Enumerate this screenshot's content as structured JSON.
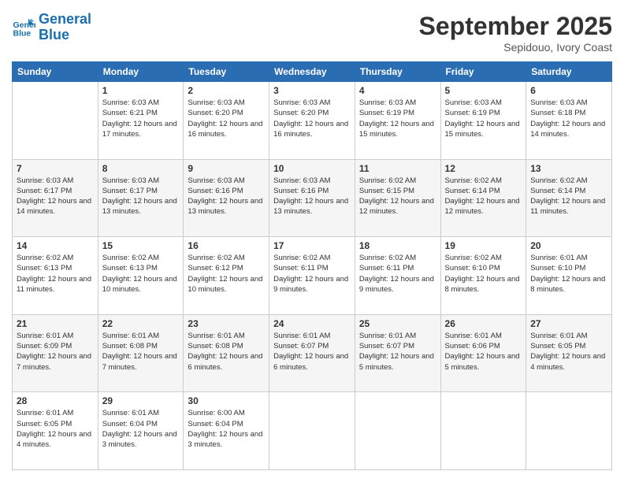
{
  "logo": {
    "line1": "General",
    "line2": "Blue"
  },
  "header": {
    "month": "September 2025",
    "location": "Sepidouo, Ivory Coast"
  },
  "weekdays": [
    "Sunday",
    "Monday",
    "Tuesday",
    "Wednesday",
    "Thursday",
    "Friday",
    "Saturday"
  ],
  "weeks": [
    [
      {
        "day": "",
        "info": ""
      },
      {
        "day": "1",
        "info": "Sunrise: 6:03 AM\nSunset: 6:21 PM\nDaylight: 12 hours\nand 17 minutes."
      },
      {
        "day": "2",
        "info": "Sunrise: 6:03 AM\nSunset: 6:20 PM\nDaylight: 12 hours\nand 16 minutes."
      },
      {
        "day": "3",
        "info": "Sunrise: 6:03 AM\nSunset: 6:20 PM\nDaylight: 12 hours\nand 16 minutes."
      },
      {
        "day": "4",
        "info": "Sunrise: 6:03 AM\nSunset: 6:19 PM\nDaylight: 12 hours\nand 15 minutes."
      },
      {
        "day": "5",
        "info": "Sunrise: 6:03 AM\nSunset: 6:19 PM\nDaylight: 12 hours\nand 15 minutes."
      },
      {
        "day": "6",
        "info": "Sunrise: 6:03 AM\nSunset: 6:18 PM\nDaylight: 12 hours\nand 14 minutes."
      }
    ],
    [
      {
        "day": "7",
        "info": "Sunrise: 6:03 AM\nSunset: 6:17 PM\nDaylight: 12 hours\nand 14 minutes."
      },
      {
        "day": "8",
        "info": "Sunrise: 6:03 AM\nSunset: 6:17 PM\nDaylight: 12 hours\nand 13 minutes."
      },
      {
        "day": "9",
        "info": "Sunrise: 6:03 AM\nSunset: 6:16 PM\nDaylight: 12 hours\nand 13 minutes."
      },
      {
        "day": "10",
        "info": "Sunrise: 6:03 AM\nSunset: 6:16 PM\nDaylight: 12 hours\nand 13 minutes."
      },
      {
        "day": "11",
        "info": "Sunrise: 6:02 AM\nSunset: 6:15 PM\nDaylight: 12 hours\nand 12 minutes."
      },
      {
        "day": "12",
        "info": "Sunrise: 6:02 AM\nSunset: 6:14 PM\nDaylight: 12 hours\nand 12 minutes."
      },
      {
        "day": "13",
        "info": "Sunrise: 6:02 AM\nSunset: 6:14 PM\nDaylight: 12 hours\nand 11 minutes."
      }
    ],
    [
      {
        "day": "14",
        "info": "Sunrise: 6:02 AM\nSunset: 6:13 PM\nDaylight: 12 hours\nand 11 minutes."
      },
      {
        "day": "15",
        "info": "Sunrise: 6:02 AM\nSunset: 6:13 PM\nDaylight: 12 hours\nand 10 minutes."
      },
      {
        "day": "16",
        "info": "Sunrise: 6:02 AM\nSunset: 6:12 PM\nDaylight: 12 hours\nand 10 minutes."
      },
      {
        "day": "17",
        "info": "Sunrise: 6:02 AM\nSunset: 6:11 PM\nDaylight: 12 hours\nand 9 minutes."
      },
      {
        "day": "18",
        "info": "Sunrise: 6:02 AM\nSunset: 6:11 PM\nDaylight: 12 hours\nand 9 minutes."
      },
      {
        "day": "19",
        "info": "Sunrise: 6:02 AM\nSunset: 6:10 PM\nDaylight: 12 hours\nand 8 minutes."
      },
      {
        "day": "20",
        "info": "Sunrise: 6:01 AM\nSunset: 6:10 PM\nDaylight: 12 hours\nand 8 minutes."
      }
    ],
    [
      {
        "day": "21",
        "info": "Sunrise: 6:01 AM\nSunset: 6:09 PM\nDaylight: 12 hours\nand 7 minutes."
      },
      {
        "day": "22",
        "info": "Sunrise: 6:01 AM\nSunset: 6:08 PM\nDaylight: 12 hours\nand 7 minutes."
      },
      {
        "day": "23",
        "info": "Sunrise: 6:01 AM\nSunset: 6:08 PM\nDaylight: 12 hours\nand 6 minutes."
      },
      {
        "day": "24",
        "info": "Sunrise: 6:01 AM\nSunset: 6:07 PM\nDaylight: 12 hours\nand 6 minutes."
      },
      {
        "day": "25",
        "info": "Sunrise: 6:01 AM\nSunset: 6:07 PM\nDaylight: 12 hours\nand 5 minutes."
      },
      {
        "day": "26",
        "info": "Sunrise: 6:01 AM\nSunset: 6:06 PM\nDaylight: 12 hours\nand 5 minutes."
      },
      {
        "day": "27",
        "info": "Sunrise: 6:01 AM\nSunset: 6:05 PM\nDaylight: 12 hours\nand 4 minutes."
      }
    ],
    [
      {
        "day": "28",
        "info": "Sunrise: 6:01 AM\nSunset: 6:05 PM\nDaylight: 12 hours\nand 4 minutes."
      },
      {
        "day": "29",
        "info": "Sunrise: 6:01 AM\nSunset: 6:04 PM\nDaylight: 12 hours\nand 3 minutes."
      },
      {
        "day": "30",
        "info": "Sunrise: 6:00 AM\nSunset: 6:04 PM\nDaylight: 12 hours\nand 3 minutes."
      },
      {
        "day": "",
        "info": ""
      },
      {
        "day": "",
        "info": ""
      },
      {
        "day": "",
        "info": ""
      },
      {
        "day": "",
        "info": ""
      }
    ]
  ]
}
